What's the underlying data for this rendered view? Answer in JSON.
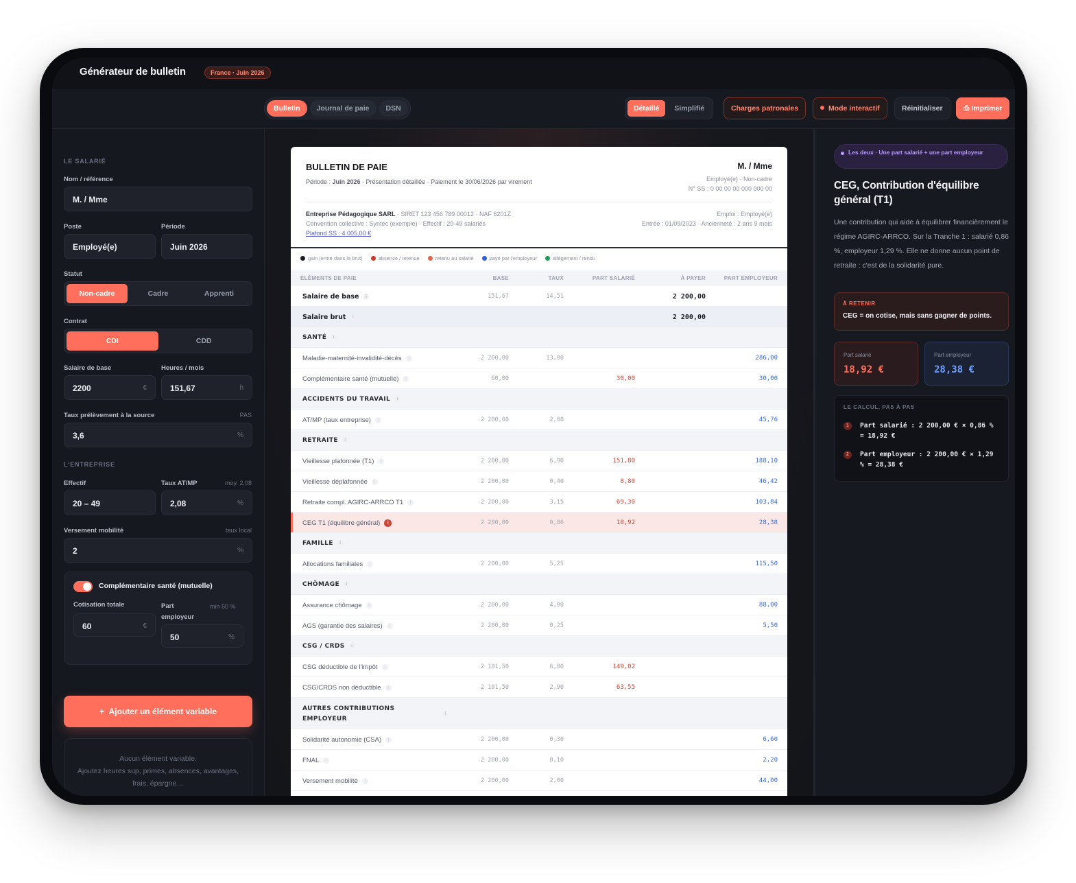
{
  "app": {
    "title": "Générateur de bulletin",
    "badge": "France · Juin 2026"
  },
  "toolbar": {
    "tabs": [
      "Bulletin",
      "Journal de paie",
      "DSN"
    ],
    "view_modes": [
      "Détaillé",
      "Simplifié"
    ],
    "charges_btn": "Charges patronales",
    "interactive_btn": "Mode interactif",
    "reset_btn": "Réinitialiser",
    "print_btn": "Imprimer"
  },
  "left": {
    "salarie_header": "LE SALARIÉ",
    "nom_label": "Nom / référence",
    "nom_value": "M. / Mme",
    "poste_label": "Poste",
    "poste_value": "Employé(e)",
    "periode_label": "Période",
    "periode_value": "Juin 2026",
    "statut_label": "Statut",
    "statut_options": [
      "Non-cadre",
      "Cadre",
      "Apprenti"
    ],
    "contrat_label": "Contrat",
    "contrat_options": [
      "CDI",
      "CDD"
    ],
    "salaire_label": "Salaire de base",
    "salaire_value": "2200",
    "salaire_unit": "€",
    "heures_label": "Heures / mois",
    "heures_value": "151,67",
    "heures_unit": "h",
    "taux_pas_label": "Taux prélèvement à la source",
    "taux_pas_right": "PAS",
    "taux_pas_value": "3,6",
    "pct": "%",
    "entreprise_header": "L'ENTREPRISE",
    "effectif_label": "Effectif",
    "effectif_value": "20 – 49",
    "atmp_label": "Taux AT/MP",
    "atmp_right": "moy. 2,08",
    "atmp_value": "2,08",
    "mobilite_label": "Versement mobilité",
    "mobilite_right": "taux local",
    "mobilite_value": "2",
    "mutuelle_title": "Complémentaire santé (mutuelle)",
    "cotisation_label": "Cotisation totale",
    "cotisation_value": "60",
    "part_label": "Part employeur",
    "part_right": "min 50 %",
    "part_value": "50",
    "add_btn": "Ajouter un élément variable",
    "empty_line1": "Aucun élément variable.",
    "empty_line2": "Ajoutez heures sup, primes, absences, avantages,",
    "empty_line3": "frais, épargne…"
  },
  "bulletin": {
    "title": "BULLETIN DE PAIE",
    "sub_prefix": "Période : ",
    "sub_period": "Juin 2026",
    "sub_rest": " · Présentation détaillée · Paiement le 30/06/2026 par virement",
    "name": "M. / Mme",
    "r1": "Employé(e) · Non-cadre",
    "r2": "N° SS : 0 00 00 00 000 000 00",
    "company": "Entreprise Pédagogique SARL",
    "company_rest": " · SIRET 123 456 789 00012 · NAF 6201Z",
    "convention": "Convention collective : Syntec (exemple) · Effectif : 20-49 salariés",
    "plafond": "Plafond SS : 4 005,00 €",
    "emploi": "Emploi : Employé(e)",
    "entree": "Entrée : 01/09/2023 · Ancienneté : 2 ans 9 mois",
    "legend": [
      {
        "label": "gain (entre dans le brut)",
        "color": "#1b1d24"
      },
      {
        "label": "absence / retenue",
        "color": "#d23b2f"
      },
      {
        "label": "retenu au salarié",
        "color": "#e0664f"
      },
      {
        "label": "payé par l'employeur",
        "color": "#2f5fe0"
      },
      {
        "label": "allègement / rendu",
        "color": "#1f9d57"
      }
    ],
    "headers": [
      "ÉLÉMENTS DE PAIE",
      "BASE",
      "TAUX",
      "PART SALARIÉ",
      "À PAYER",
      "PART EMPLOYEUR"
    ],
    "rows": [
      {
        "type": "bold",
        "name": "Salaire de base",
        "base": "151,67",
        "taux": "14,51",
        "sal": "",
        "pay": "2 200,00",
        "emp": ""
      },
      {
        "type": "brut",
        "name": "Salaire brut",
        "base": "",
        "taux": "",
        "sal": "",
        "pay": "2 200,00",
        "emp": ""
      },
      {
        "type": "cat",
        "name": "SANTÉ"
      },
      {
        "type": "line",
        "name": "Maladie-maternité-invalidité-décès",
        "base": "2 200,00",
        "taux": "13,00",
        "sal": "",
        "pay": "",
        "emp": "286,00"
      },
      {
        "type": "line",
        "name": "Complémentaire santé (mutuelle)",
        "base": "60,00",
        "taux": "",
        "sal": "30,00",
        "pay": "",
        "emp": "30,00"
      },
      {
        "type": "cat",
        "name": "ACCIDENTS DU TRAVAIL"
      },
      {
        "type": "line",
        "name": "AT/MP (taux entreprise)",
        "base": "2 200,00",
        "taux": "2,08",
        "sal": "",
        "pay": "",
        "emp": "45,76"
      },
      {
        "type": "cat",
        "name": "RETRAITE"
      },
      {
        "type": "line",
        "name": "Vieillesse plafonnée (T1)",
        "base": "2 200,00",
        "taux": "6,90",
        "sal": "151,80",
        "pay": "",
        "emp": "188,10"
      },
      {
        "type": "line",
        "name": "Vieillesse déplafonnée",
        "base": "2 200,00",
        "taux": "0,40",
        "sal": "8,80",
        "pay": "",
        "emp": "46,42"
      },
      {
        "type": "line",
        "name": "Retraite compl. AGIRC-ARRCO T1",
        "base": "2 200,00",
        "taux": "3,15",
        "sal": "69,30",
        "pay": "",
        "emp": "103,84"
      },
      {
        "type": "hl",
        "name": "CEG T1 (équilibre général)",
        "base": "2 200,00",
        "taux": "0,86",
        "sal": "18,92",
        "pay": "",
        "emp": "28,38"
      },
      {
        "type": "cat",
        "name": "FAMILLE"
      },
      {
        "type": "line",
        "name": "Allocations familiales",
        "base": "2 200,00",
        "taux": "5,25",
        "sal": "",
        "pay": "",
        "emp": "115,50"
      },
      {
        "type": "cat",
        "name": "CHÔMAGE"
      },
      {
        "type": "line",
        "name": "Assurance chômage",
        "base": "2 200,00",
        "taux": "4,00",
        "sal": "",
        "pay": "",
        "emp": "88,00"
      },
      {
        "type": "line",
        "name": "AGS (garantie des salaires)",
        "base": "2 200,00",
        "taux": "0,25",
        "sal": "",
        "pay": "",
        "emp": "5,50"
      },
      {
        "type": "cat",
        "name": "CSG / CRDS"
      },
      {
        "type": "line",
        "name": "CSG déductible de l'impôt",
        "base": "2 191,50",
        "taux": "6,80",
        "sal": "149,02",
        "pay": "",
        "emp": ""
      },
      {
        "type": "line",
        "name": "CSG/CRDS non déductible",
        "base": "2 191,50",
        "taux": "2,90",
        "sal": "63,55",
        "pay": "",
        "emp": ""
      },
      {
        "type": "cat2",
        "name": "AUTRES CONTRIBUTIONS",
        "name2": "EMPLOYEUR"
      },
      {
        "type": "line",
        "name": "Solidarité autonomie (CSA)",
        "base": "2 200,00",
        "taux": "0,30",
        "sal": "",
        "pay": "",
        "emp": "6,60"
      },
      {
        "type": "line",
        "name": "FNAL",
        "base": "2 200,00",
        "taux": "0,10",
        "sal": "",
        "pay": "",
        "emp": "2,20"
      },
      {
        "type": "line",
        "name": "Versement mobilité",
        "base": "2 200,00",
        "taux": "2,00",
        "sal": "",
        "pay": "",
        "emp": "44,00"
      }
    ]
  },
  "right": {
    "pill": "Les deux · Une part salarié + une part employeur",
    "title": "CEG, Contribution d'équilibre général (T1)",
    "desc": "Une contribution qui aide à équilibrer financièrement le régime AGIRC-ARRCO. Sur la Tranche 1 : salarié 0,86 %, employeur 1,29 %. Elle ne donne aucun point de retraite : c'est de la solidarité pure.",
    "retenir_k": "À RETENIR",
    "retenir_v": "CEG = on cotise, mais sans gagner de points.",
    "sal_k": "Part salarié",
    "sal_v": "18,92 €",
    "emp_k": "Part employeur",
    "emp_v": "28,38 €",
    "calc_h": "LE CALCUL, PAS À PAS",
    "step1_n": "1",
    "step1": "Part salarié : 2 200,00 € × 0,86 % = 18,92 €",
    "step2_n": "2",
    "step2": "Part employeur : 2 200,00 € × 1,29 % = 28,38 €"
  }
}
